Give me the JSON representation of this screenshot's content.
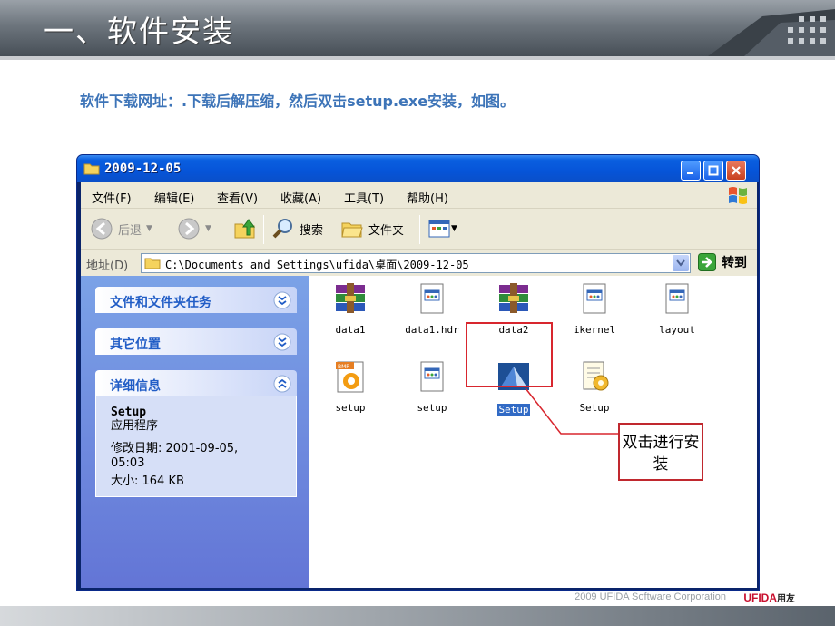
{
  "slide": {
    "title": "一、软件安装",
    "intro": "软件下载网址：.下载后解压缩，然后双击setup.exe安装，如图。",
    "callout": "双击进行安装",
    "footer": "2009 UFIDA Software Corporation",
    "footer_brand": "UFIDA",
    "footer_brand_cn": "用友"
  },
  "window": {
    "title": "2009-12-05",
    "menu": [
      "文件(F)",
      "编辑(E)",
      "查看(V)",
      "收藏(A)",
      "工具(T)",
      "帮助(H)"
    ],
    "toolbar": {
      "back": "后退",
      "search": "搜索",
      "folders": "文件夹"
    },
    "address": {
      "label": "地址(D)",
      "value": "C:\\Documents and Settings\\ufida\\桌面\\2009-12-05",
      "go": "转到"
    },
    "tasks": {
      "file_tasks": "文件和文件夹任务",
      "other_places": "其它位置",
      "details": "详细信息"
    },
    "details": {
      "name": "Setup",
      "type": "应用程序",
      "modified_label": "修改日期: 2001-09-05,",
      "modified_time": "05:03",
      "size": "大小: 164 KB"
    },
    "files": [
      {
        "label": "data1",
        "icon": "winrar-archive-icon"
      },
      {
        "label": "data1.hdr",
        "icon": "generic-file-icon"
      },
      {
        "label": "data2",
        "icon": "winrar-archive-icon"
      },
      {
        "label": "ikernel",
        "icon": "generic-file-icon"
      },
      {
        "label": "layout",
        "icon": "generic-file-icon"
      },
      {
        "label": "setup",
        "icon": "bmp-image-icon"
      },
      {
        "label": "setup",
        "icon": "generic-file-icon"
      },
      {
        "label": "Setup",
        "icon": "setup-app-icon",
        "selected": true
      },
      {
        "label": "Setup",
        "icon": "setup-config-icon"
      }
    ]
  }
}
